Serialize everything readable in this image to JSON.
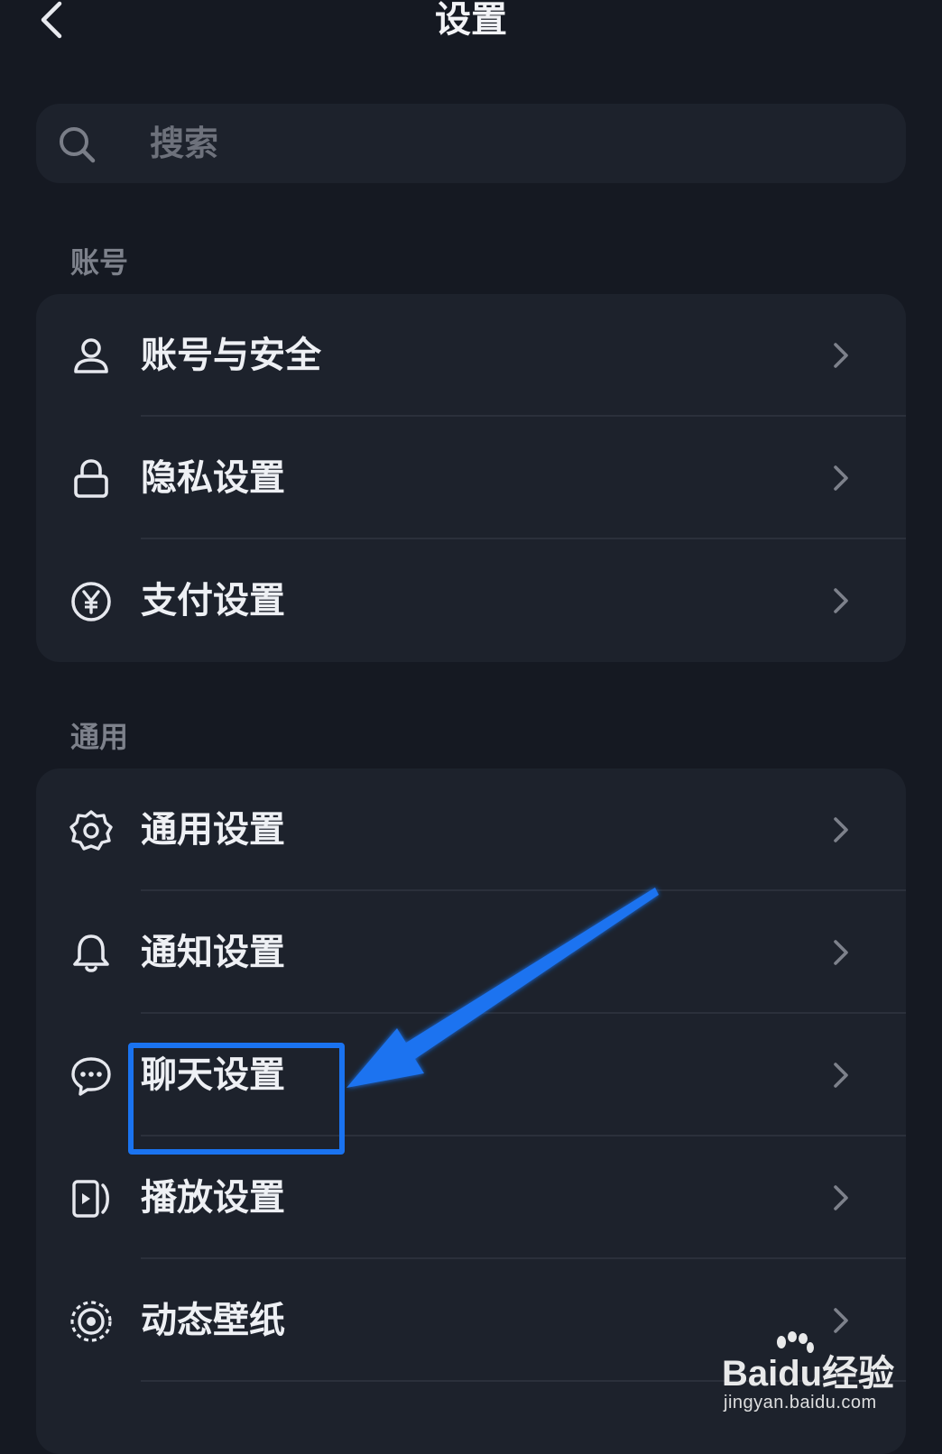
{
  "header": {
    "title": "设置",
    "back_icon": "chevron-left-icon"
  },
  "search": {
    "placeholder": "搜索",
    "icon": "search-icon"
  },
  "sections": [
    {
      "label": "账号",
      "items": [
        {
          "label": "账号与安全",
          "icon": "user-icon"
        },
        {
          "label": "隐私设置",
          "icon": "lock-icon"
        },
        {
          "label": "支付设置",
          "icon": "yuan-icon"
        }
      ]
    },
    {
      "label": "通用",
      "items": [
        {
          "label": "通用设置",
          "icon": "gear-icon"
        },
        {
          "label": "通知设置",
          "icon": "bell-icon"
        },
        {
          "label": "聊天设置",
          "icon": "chat-bubble-icon"
        },
        {
          "label": "播放设置",
          "icon": "player-icon"
        },
        {
          "label": "动态壁纸",
          "icon": "live-wallpaper-icon"
        }
      ]
    }
  ],
  "annotation": {
    "highlighted_item": "聊天设置",
    "color": "#1a73f0"
  },
  "watermark": {
    "brand": "Baidu经验",
    "url": "jingyan.baidu.com"
  },
  "colors": {
    "background": "#151922",
    "card": "#1d222c",
    "text": "#eef0f4",
    "muted": "#7d818b"
  }
}
